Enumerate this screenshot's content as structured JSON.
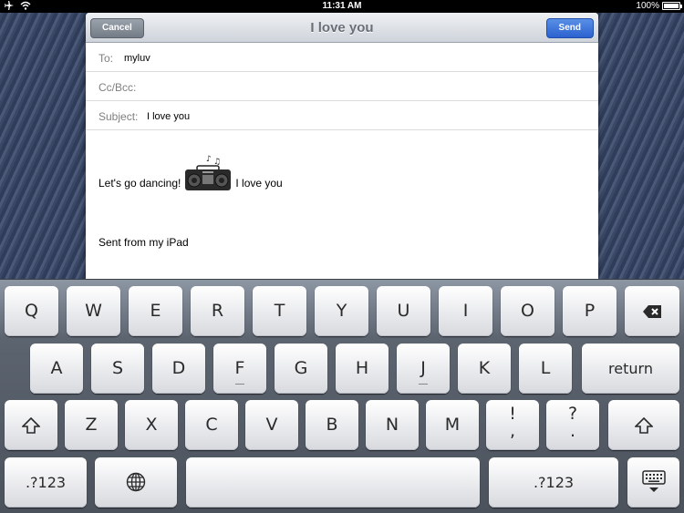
{
  "status_bar": {
    "time": "11:31 AM",
    "battery": "100%",
    "battery_level": 1.0,
    "icons": [
      "airplane-icon",
      "wifi-icon",
      "battery-icon"
    ]
  },
  "compose": {
    "title": "I love you",
    "cancel_label": "Cancel",
    "send_label": "Send",
    "to_label": "To:",
    "to_value": "myluv",
    "cc_label": "Cc/Bcc:",
    "subject_label": "Subject:",
    "subject_value": "I love you",
    "body_text_before": "Let's go dancing!",
    "body_text_after": "I love you",
    "signature": "Sent from my iPad",
    "accent": "#2b62cf"
  },
  "keyboard": {
    "row1": [
      "Q",
      "W",
      "E",
      "R",
      "T",
      "Y",
      "U",
      "I",
      "O",
      "P"
    ],
    "row2": [
      "A",
      "S",
      "D",
      "F",
      "G",
      "H",
      "J",
      "K",
      "L"
    ],
    "return_label": "return",
    "row3": [
      "Z",
      "X",
      "C",
      "V",
      "B",
      "N",
      "M"
    ],
    "excl_top": "!",
    "excl_bottom": ",",
    "quest_top": "?",
    "quest_bottom": ".",
    "numbers_label": ".?123"
  }
}
